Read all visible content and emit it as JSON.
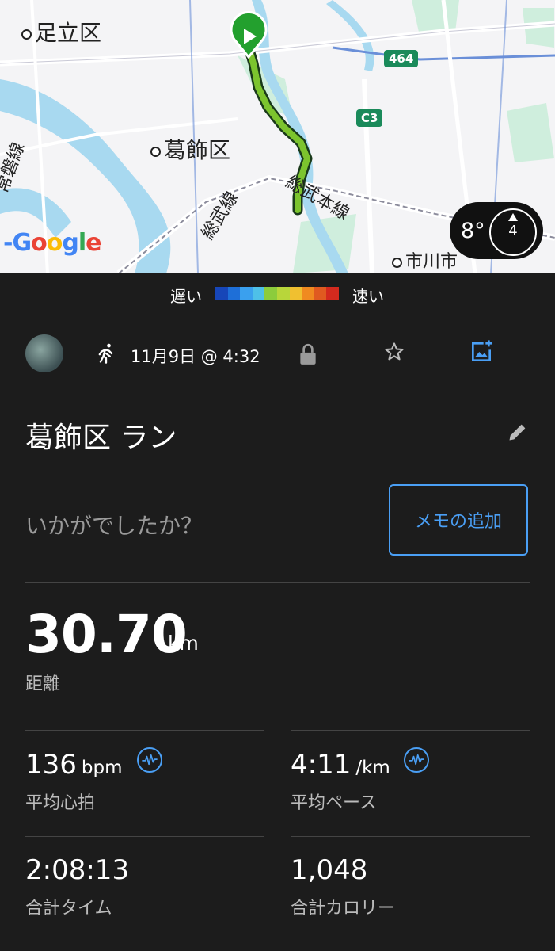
{
  "map": {
    "labels": {
      "adachi": "足立区",
      "katsushika": "葛飾区",
      "ichikawa": "市川市",
      "joban": "常磐線",
      "sobu": "総武線",
      "sobu_main": "総武本線"
    },
    "road_464": "464",
    "road_c3": "C3",
    "google_logo": "Google",
    "weather": {
      "temp": "8°",
      "dial_value": "4"
    },
    "start_icon": "play-icon"
  },
  "legend": {
    "slow": "遅い",
    "fast": "速い",
    "colors": [
      "#1746b8",
      "#1e6fd8",
      "#3aa0ee",
      "#4ec0e8",
      "#8ccc3c",
      "#b8d63a",
      "#f0c030",
      "#f08a20",
      "#e05a20",
      "#d42a1e"
    ]
  },
  "activity": {
    "date": "11月9日 @ 4:32",
    "title": "葛飾区 ラン",
    "prompt": "いかがでしたか？",
    "memo_button": "メモの追加"
  },
  "stats": {
    "distance": {
      "value": "30.70",
      "unit": "km",
      "label": "距離"
    },
    "heart_rate": {
      "value": "136",
      "unit": "bpm",
      "label": "平均心拍"
    },
    "pace": {
      "value": "4:11",
      "unit": "/km",
      "label": "平均ペース"
    },
    "time": {
      "value": "2:08:13",
      "label": "合計タイム"
    },
    "calories": {
      "value": "1,048",
      "label": "合計カロリー"
    }
  },
  "accent": "#4a9ff5"
}
